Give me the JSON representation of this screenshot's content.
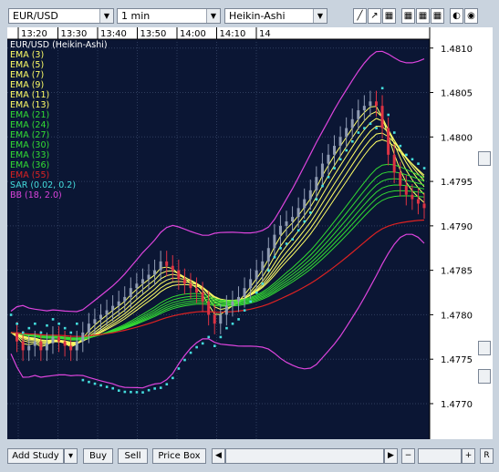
{
  "toolbar": {
    "symbol": "EUR/USD",
    "interval": "1 min",
    "chart_type": "Heikin-Ashi",
    "tools": [
      "draw-line-icon",
      "pointer-icon",
      "grid-icon",
      "grid-icon",
      "grid-icon",
      "color-icon",
      "color-icon"
    ]
  },
  "chart_data": {
    "type": "candlestick",
    "title": "EUR/USD (Heikin-Ashi)",
    "x_ticks": [
      "13:20",
      "13:30",
      "13:40",
      "13:50",
      "14:00",
      "14:10",
      "14"
    ],
    "y_ticks": [
      "1.4810",
      "1.4805",
      "1.4800",
      "1.4795",
      "1.4790",
      "1.4785",
      "1.4780",
      "1.4775",
      "1.4770"
    ],
    "ylim": [
      1.4766,
      1.4811
    ],
    "grid": true,
    "legend_position": "top-left",
    "indicators": [
      {
        "name": "EMA (3)",
        "color": "#ffff66"
      },
      {
        "name": "EMA (5)",
        "color": "#ffff66"
      },
      {
        "name": "EMA (7)",
        "color": "#ffff66"
      },
      {
        "name": "EMA (9)",
        "color": "#ffff66"
      },
      {
        "name": "EMA (11)",
        "color": "#ffff66"
      },
      {
        "name": "EMA (13)",
        "color": "#ffff66"
      },
      {
        "name": "EMA (21)",
        "color": "#33dd33"
      },
      {
        "name": "EMA (24)",
        "color": "#33dd33"
      },
      {
        "name": "EMA (27)",
        "color": "#33dd33"
      },
      {
        "name": "EMA (30)",
        "color": "#33dd33"
      },
      {
        "name": "EMA (33)",
        "color": "#33dd33"
      },
      {
        "name": "EMA (36)",
        "color": "#33dd33"
      },
      {
        "name": "EMA (55)",
        "color": "#dd2222"
      },
      {
        "name": "SAR (0.02, 0.2)",
        "color": "#44dddd"
      },
      {
        "name": "BB (18, 2.0)",
        "color": "#dd44dd"
      }
    ],
    "price_series": [
      1.4778,
      1.4777,
      1.4776,
      1.47765,
      1.4777,
      1.4776,
      1.47768,
      1.47775,
      1.4777,
      1.47765,
      1.4776,
      1.4777,
      1.4778,
      1.4779,
      1.47795,
      1.478,
      1.47805,
      1.4781,
      1.47815,
      1.4782,
      1.4783,
      1.47835,
      1.4784,
      1.47845,
      1.4785,
      1.4786,
      1.47855,
      1.4785,
      1.4784,
      1.47835,
      1.4783,
      1.47825,
      1.47815,
      1.478,
      1.4779,
      1.478,
      1.4781,
      1.47815,
      1.4782,
      1.4783,
      1.4784,
      1.4785,
      1.4786,
      1.47875,
      1.4789,
      1.479,
      1.47905,
      1.4791,
      1.4792,
      1.4793,
      1.4794,
      1.47955,
      1.4797,
      1.4798,
      1.4799,
      1.48,
      1.4801,
      1.4802,
      1.4803,
      1.48035,
      1.4804,
      1.48035,
      1.4801,
      1.4798,
      1.4796,
      1.47945,
      1.47935,
      1.4793,
      1.47925,
      1.4792
    ]
  },
  "bottom": {
    "add_study": "Add Study",
    "buy": "Buy",
    "sell": "Sell",
    "price_box": "Price Box",
    "zoom_out": "−",
    "zoom_in": "+",
    "reset": "R"
  }
}
